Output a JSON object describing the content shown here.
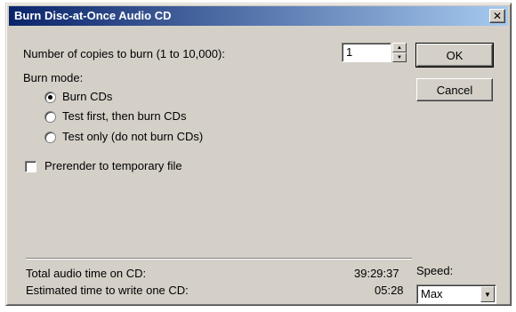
{
  "window": {
    "title": "Burn Disc-at-Once Audio CD",
    "close_glyph": "✕"
  },
  "copies": {
    "label": "Number of copies to burn (1 to 10,000):",
    "value": "1"
  },
  "burn_mode": {
    "label": "Burn mode:",
    "selected_index": 0,
    "options": [
      "Burn CDs",
      "Test first, then burn CDs",
      "Test only (do not burn CDs)"
    ]
  },
  "prerender": {
    "label": "Prerender to temporary file",
    "checked": false
  },
  "buttons": {
    "ok": "OK",
    "cancel": "Cancel"
  },
  "stats": {
    "total_label": "Total audio time on CD:",
    "total_value": "39:29:37",
    "estimate_label": "Estimated time to write one CD:",
    "estimate_value": "05:28"
  },
  "speed": {
    "label": "Speed:",
    "value": "Max"
  },
  "colors": {
    "dialog_face": "#d4d0c8",
    "title_start": "#0a246a",
    "title_end": "#a6caf0"
  }
}
